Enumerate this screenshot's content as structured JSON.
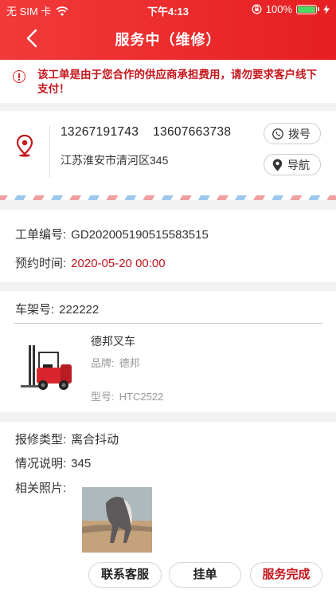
{
  "status_bar": {
    "carrier": "无 SIM 卡",
    "time": "下午4:13",
    "battery": "100%",
    "icons": [
      "wifi-icon",
      "orientation-lock-icon",
      "battery-icon",
      "charging-icon"
    ]
  },
  "nav": {
    "title": "服务中（维修）",
    "back_icon": "chevron-left-icon"
  },
  "notice": {
    "text": "该工单是由于您合作的供应商承担费用，请勿要求客户线下支付！",
    "icon": "alert-circle-icon"
  },
  "customer": {
    "phone1": "13267191743",
    "phone2": "13607663738",
    "address": "江苏淮安市清河区345",
    "call_label": "拨号",
    "nav_label": "导航"
  },
  "order": {
    "number_label": "工单编号:",
    "number": "GD202005190515583515",
    "time_label": "预约时间:",
    "time": "2020-05-20 00:00"
  },
  "vehicle": {
    "frame_label": "车架号:",
    "frame": "222222",
    "name": "德邦叉车",
    "brand_label": "品牌:",
    "brand": "德邦",
    "model_label": "型号:",
    "model": "HTC2522"
  },
  "repair": {
    "type_label": "报修类型:",
    "type": "离合抖动",
    "desc_label": "情况说明:",
    "desc": "345",
    "photos_label": "相关照片:"
  },
  "actions": {
    "contact": "联系客服",
    "hang": "挂单",
    "complete": "服务完成"
  },
  "colors": {
    "brand": "#e51f22",
    "accent_text": "#c4161c"
  }
}
